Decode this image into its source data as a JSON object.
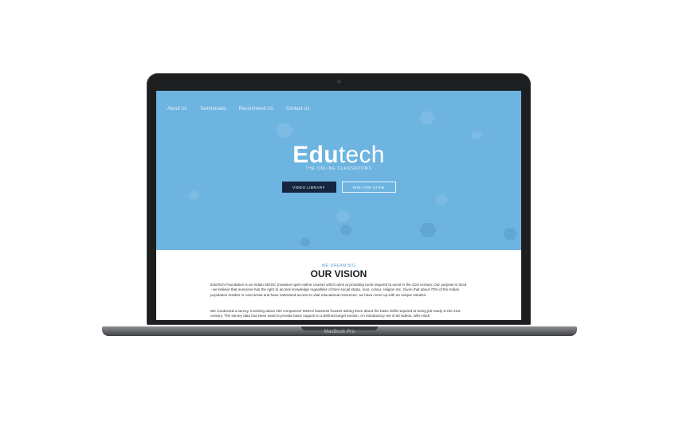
{
  "nav": {
    "items": [
      "About Us",
      "Testimonials",
      "Recommend Us",
      "Contact Us"
    ]
  },
  "hero": {
    "logo_bold": "Edu",
    "logo_light": "tech",
    "tagline": "THE ONLINE CLASSROOMS",
    "btn_primary": "VIDEO LIBRARY",
    "btn_secondary": "SHE FOR STEM"
  },
  "vision": {
    "kicker": "WE DREAM BIG",
    "title": "OUR VISION",
    "para1": "EduTech Foundation is an Indian MOOC (massive open-online course) which aims at providing tools required to excel in the 21st century. Our purpose is lucid - we believe that everyone has the right to access knowledge regardless of their social strata, race, colour, religion etc. Given that about 70% of the Indian population resides in rural areas and have restrained access to vital educational resources, we have come up with an unique solution.",
    "para2": "We conducted a survey, involving about 100 companies/ MNCs/ business houses asking them about the basic skills required to being job-ready in the 21st century. The survey data has been used to provide basic support to a defined target section. An introductory set of 50 videos, with Hindi"
  },
  "device": {
    "label": "MacBook Pro"
  },
  "colors": {
    "hero_bg": "#6eb4e0",
    "primary_button": "#14263f",
    "accent": "#5aa6d8"
  }
}
